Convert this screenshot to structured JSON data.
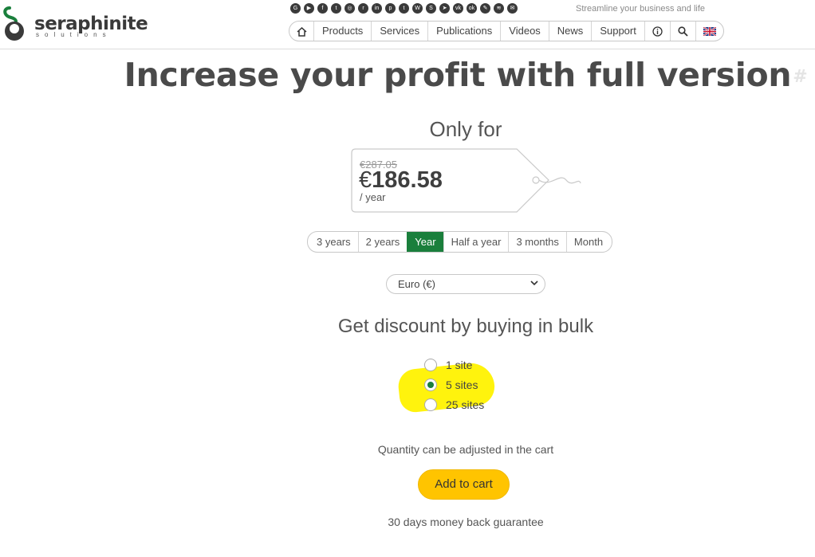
{
  "header": {
    "logo_text": "seraphinite",
    "logo_sub": "solutions",
    "tagline": "Streamline your business and life",
    "social_icons": [
      "google-icon",
      "youtube-icon",
      "facebook-icon",
      "twitter-icon",
      "instagram-icon",
      "reddit-icon",
      "linkedin-icon",
      "pinterest-icon",
      "tumblr-icon",
      "wordpress-icon",
      "skype-icon",
      "telegram-icon",
      "vk-icon",
      "odnoklassniki-icon",
      "livejournal-icon",
      "rss-icon",
      "email-icon"
    ],
    "nav": {
      "home_icon": "home-icon",
      "products": "Products",
      "services": "Services",
      "publications": "Publications",
      "videos": "Videos",
      "news": "News",
      "support": "Support",
      "info_icon": "info-icon",
      "search_icon": "search-icon",
      "lang_icon": "uk-flag-icon"
    }
  },
  "hero": {
    "title": "Increase your profit with full version",
    "anchor": "#"
  },
  "pricing": {
    "only_for": "Only for",
    "old_price": "€287.05",
    "currency_symbol": "€",
    "price": "186.58",
    "per": "/ year",
    "periods": [
      "3 years",
      "2 years",
      "Year",
      "Half a year",
      "3 months",
      "Month"
    ],
    "active_period": "Year",
    "currency_select": "Euro (€)"
  },
  "bulk": {
    "title": "Get discount by buying in bulk",
    "options": [
      "1 site",
      "5 sites",
      "25 sites"
    ],
    "selected": "5 sites",
    "qty_note": "Quantity can be adjusted in the cart",
    "add_to_cart": "Add to cart",
    "guarantee": "30 days money back guarantee"
  },
  "colors": {
    "accent_green": "#1a7f3c",
    "cart_yellow": "#ffc400",
    "highlight": "#fff200"
  }
}
